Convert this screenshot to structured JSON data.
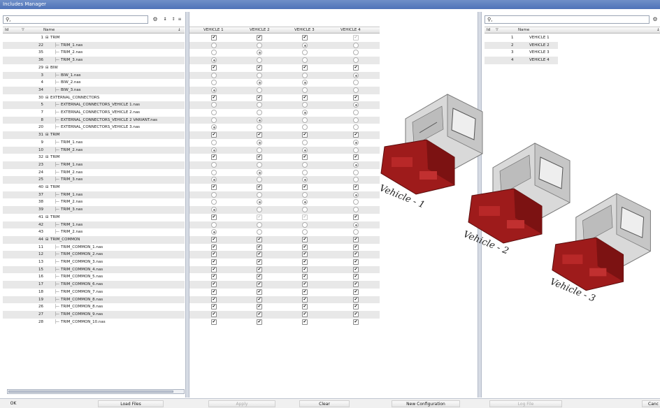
{
  "window": {
    "title": "Includes Manager"
  },
  "left_panel": {
    "search_placeholder": "",
    "search_icon": "search-icon",
    "headers": {
      "id": "Id",
      "name": "Name"
    },
    "rows": [
      {
        "id": "1",
        "name": "TRIM",
        "level": 0
      },
      {
        "id": "22",
        "name": "TRIM_1.nas",
        "level": 1
      },
      {
        "id": "35",
        "name": "TRIM_2.nas",
        "level": 1
      },
      {
        "id": "36",
        "name": "TRIM_3.nas",
        "level": 1
      },
      {
        "id": "29",
        "name": "BIW",
        "level": 0
      },
      {
        "id": "3",
        "name": "BIW_1.nas",
        "level": 1
      },
      {
        "id": "4",
        "name": "BIW_2.nas",
        "level": 1
      },
      {
        "id": "34",
        "name": "BIW_3.nas",
        "level": 1
      },
      {
        "id": "30",
        "name": "EXTERNAL_CONNECTORS",
        "level": 0
      },
      {
        "id": "5",
        "name": "EXTERNAL_CONNECTORS_VEHICLE 1.nas",
        "level": 1
      },
      {
        "id": "7",
        "name": "EXTERNAL_CONNECTORS_VEHICLE 2.nas",
        "level": 1
      },
      {
        "id": "8",
        "name": "EXTERNAL_CONNECTORS_VEHICLE 2 VARIANT.nas",
        "level": 1
      },
      {
        "id": "20",
        "name": "EXTERNAL_CONNECTORS_VEHICLE 3.nas",
        "level": 1
      },
      {
        "id": "31",
        "name": "TRIM",
        "level": 0
      },
      {
        "id": "9",
        "name": "TRIM_1.nas",
        "level": 1
      },
      {
        "id": "10",
        "name": "TRIM_2.nas",
        "level": 1
      },
      {
        "id": "32",
        "name": "TRIM",
        "level": 0
      },
      {
        "id": "23",
        "name": "TRIM_1.nas",
        "level": 1
      },
      {
        "id": "24",
        "name": "TRIM_2.nas",
        "level": 1
      },
      {
        "id": "25",
        "name": "TRIM_3.nas",
        "level": 1
      },
      {
        "id": "40",
        "name": "TRIM",
        "level": 0
      },
      {
        "id": "37",
        "name": "TRIM_1.nas",
        "level": 1
      },
      {
        "id": "38",
        "name": "TRIM_2.nas",
        "level": 1
      },
      {
        "id": "39",
        "name": "TRIM_3.nas",
        "level": 1
      },
      {
        "id": "41",
        "name": "TRIM",
        "level": 0
      },
      {
        "id": "42",
        "name": "TRIM_1.nas",
        "level": 1
      },
      {
        "id": "43",
        "name": "TRIM_2.nas",
        "level": 1
      },
      {
        "id": "44",
        "name": "TRIM_COMMON",
        "level": 0
      },
      {
        "id": "11",
        "name": "TRIM_COMMON_1.nas",
        "level": 1
      },
      {
        "id": "12",
        "name": "TRIM_COMMON_2.nas",
        "level": 1
      },
      {
        "id": "13",
        "name": "TRIM_COMMON_3.nas",
        "level": 1
      },
      {
        "id": "15",
        "name": "TRIM_COMMON_4.nas",
        "level": 1
      },
      {
        "id": "16",
        "name": "TRIM_COMMON_5.nas",
        "level": 1
      },
      {
        "id": "17",
        "name": "TRIM_COMMON_6.nas",
        "level": 1
      },
      {
        "id": "18",
        "name": "TRIM_COMMON_7.nas",
        "level": 1
      },
      {
        "id": "19",
        "name": "TRIM_COMMON_8.nas",
        "level": 1
      },
      {
        "id": "26",
        "name": "TRIM_COMMON_8.nas",
        "level": 1
      },
      {
        "id": "27",
        "name": "TRIM_COMMON_9.nas",
        "level": 1
      },
      {
        "id": "28",
        "name": "TRIM_COMMON_10.nas",
        "level": 1
      }
    ]
  },
  "matrix": {
    "columns": [
      "VEHICLE 1",
      "VEHICLE 2",
      "VEHICLE 3",
      "VEHICLE 4"
    ],
    "cells": [
      [
        "c",
        "c",
        "c",
        "d"
      ],
      [
        "r",
        "r",
        "R",
        "r"
      ],
      [
        "r",
        "R",
        "r",
        "r"
      ],
      [
        "R",
        "r",
        "r",
        "r"
      ],
      [
        "c",
        "c",
        "c",
        "c"
      ],
      [
        "r",
        "r",
        "r",
        "R"
      ],
      [
        "r",
        "R",
        "R",
        "r"
      ],
      [
        "R",
        "r",
        "r",
        "r"
      ],
      [
        "c",
        "c",
        "c",
        "c"
      ],
      [
        "r",
        "r",
        "r",
        "R"
      ],
      [
        "r",
        "r",
        "R",
        "r"
      ],
      [
        "r",
        "R",
        "r",
        "r"
      ],
      [
        "R",
        "r",
        "r",
        "r"
      ],
      [
        "c",
        "c",
        "c",
        "c"
      ],
      [
        "r",
        "R",
        "r",
        "R"
      ],
      [
        "R",
        "r",
        "R",
        "r"
      ],
      [
        "c",
        "c",
        "c",
        "c"
      ],
      [
        "r",
        "r",
        "r",
        "R"
      ],
      [
        "r",
        "R",
        "r",
        "r"
      ],
      [
        "R",
        "r",
        "R",
        "r"
      ],
      [
        "c",
        "c",
        "c",
        "c"
      ],
      [
        "r",
        "r",
        "r",
        "R"
      ],
      [
        "r",
        "R",
        "R",
        "r"
      ],
      [
        "R",
        "r",
        "r",
        "r"
      ],
      [
        "c",
        "d",
        "d",
        "c"
      ],
      [
        "r",
        "r",
        "r",
        "R"
      ],
      [
        "R",
        "r",
        "r",
        "r"
      ],
      [
        "c",
        "c",
        "c",
        "c"
      ],
      [
        "c",
        "c",
        "c",
        "c"
      ],
      [
        "c",
        "c",
        "c",
        "c"
      ],
      [
        "c",
        "c",
        "c",
        "c"
      ],
      [
        "c",
        "c",
        "c",
        "c"
      ],
      [
        "c",
        "c",
        "c",
        "c"
      ],
      [
        "c",
        "c",
        "c",
        "c"
      ],
      [
        "c",
        "c",
        "c",
        "c"
      ],
      [
        "c",
        "c",
        "c",
        "c"
      ],
      [
        "c",
        "c",
        "c",
        "c"
      ],
      [
        "c",
        "c",
        "c",
        "c"
      ],
      [
        "c",
        "c",
        "c",
        "c"
      ]
    ]
  },
  "right_panel": {
    "headers": {
      "id": "Id",
      "name": "Name"
    },
    "rows": [
      {
        "id": "1",
        "name": "VEHICLE 1"
      },
      {
        "id": "2",
        "name": "VEHICLE 2"
      },
      {
        "id": "3",
        "name": "VEHICLE 3"
      },
      {
        "id": "4",
        "name": "VEHICLE 4"
      }
    ]
  },
  "overlay_labels": [
    "Vehicle - 1",
    "Vehicle - 2",
    "Vehicle - 3"
  ],
  "bottom_bar": {
    "ok": "OK",
    "load_files": "Load Files",
    "apply": "Apply",
    "clear": "Clear",
    "new_configuration": "New Configuration",
    "log_file": "Log File",
    "cancel": "Canc"
  },
  "colors": {
    "cab_body": "#d9d9d9",
    "chassis": "#9e1b1b",
    "accent": "#4f73b8"
  }
}
